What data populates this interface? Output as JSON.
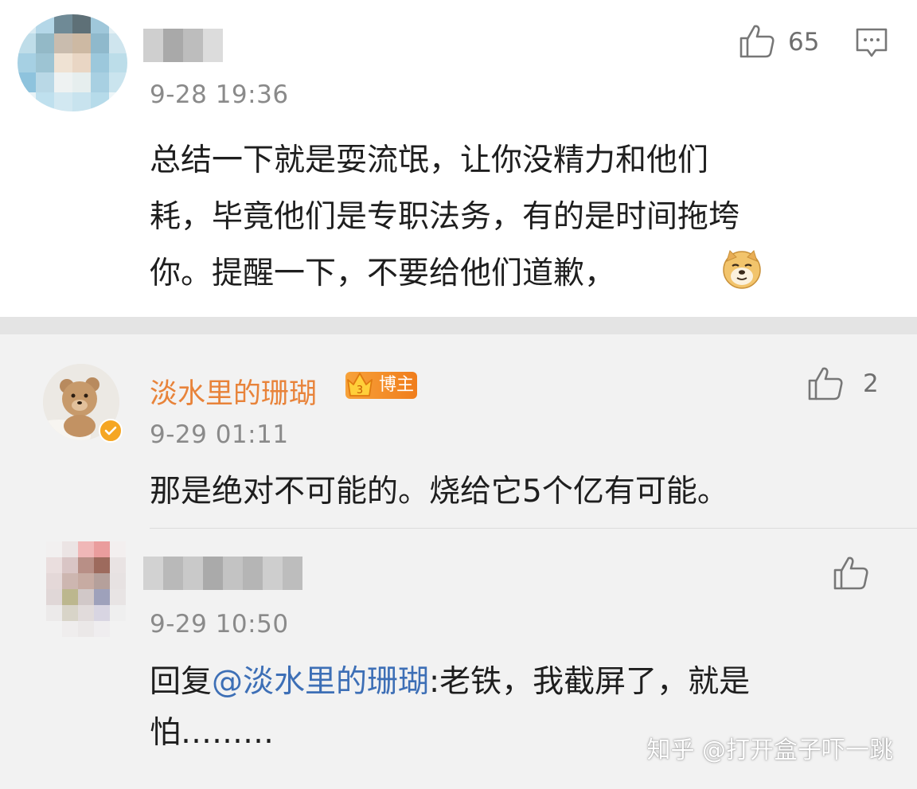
{
  "comments": [
    {
      "time": "9-28 19:36",
      "like_count": "65",
      "text_lines": [
        "总结一下就是耍流氓，让你没精力和他们",
        "耗，毕竟他们是专职法务，有的是时间拖垮",
        "你。提醒一下，不要给他们道歉，"
      ],
      "emoji_icon": "doge-emoji-icon"
    }
  ],
  "replies": [
    {
      "username": "淡水里的珊瑚",
      "badge_label": "博主",
      "time": "9-29 01:11",
      "like_count": "2",
      "text": "那是绝对不可能的。烧给它5个亿有可能。"
    },
    {
      "time": "9-29 10:50",
      "reply_prefix": "回复",
      "mention": "@淡水里的珊瑚",
      "text_line1": ":老铁，我截屏了，就是",
      "text_line2": "怕………"
    }
  ],
  "watermark": "知乎 @打开盒子吓一跳",
  "colors": {
    "username": "#e8833a",
    "mention": "#3d6fb6",
    "badge": "#f07d1c",
    "verified": "#f5a623"
  }
}
